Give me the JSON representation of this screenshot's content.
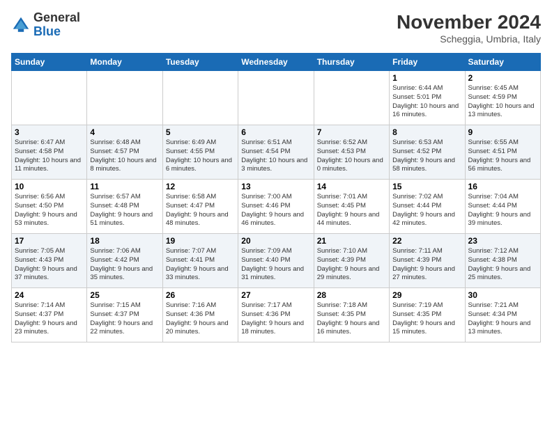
{
  "header": {
    "logo_general": "General",
    "logo_blue": "Blue",
    "month_title": "November 2024",
    "location": "Scheggia, Umbria, Italy"
  },
  "weekdays": [
    "Sunday",
    "Monday",
    "Tuesday",
    "Wednesday",
    "Thursday",
    "Friday",
    "Saturday"
  ],
  "weeks": [
    [
      {
        "day": "",
        "info": ""
      },
      {
        "day": "",
        "info": ""
      },
      {
        "day": "",
        "info": ""
      },
      {
        "day": "",
        "info": ""
      },
      {
        "day": "",
        "info": ""
      },
      {
        "day": "1",
        "info": "Sunrise: 6:44 AM\nSunset: 5:01 PM\nDaylight: 10 hours and 16 minutes."
      },
      {
        "day": "2",
        "info": "Sunrise: 6:45 AM\nSunset: 4:59 PM\nDaylight: 10 hours and 13 minutes."
      }
    ],
    [
      {
        "day": "3",
        "info": "Sunrise: 6:47 AM\nSunset: 4:58 PM\nDaylight: 10 hours and 11 minutes."
      },
      {
        "day": "4",
        "info": "Sunrise: 6:48 AM\nSunset: 4:57 PM\nDaylight: 10 hours and 8 minutes."
      },
      {
        "day": "5",
        "info": "Sunrise: 6:49 AM\nSunset: 4:55 PM\nDaylight: 10 hours and 6 minutes."
      },
      {
        "day": "6",
        "info": "Sunrise: 6:51 AM\nSunset: 4:54 PM\nDaylight: 10 hours and 3 minutes."
      },
      {
        "day": "7",
        "info": "Sunrise: 6:52 AM\nSunset: 4:53 PM\nDaylight: 10 hours and 0 minutes."
      },
      {
        "day": "8",
        "info": "Sunrise: 6:53 AM\nSunset: 4:52 PM\nDaylight: 9 hours and 58 minutes."
      },
      {
        "day": "9",
        "info": "Sunrise: 6:55 AM\nSunset: 4:51 PM\nDaylight: 9 hours and 56 minutes."
      }
    ],
    [
      {
        "day": "10",
        "info": "Sunrise: 6:56 AM\nSunset: 4:50 PM\nDaylight: 9 hours and 53 minutes."
      },
      {
        "day": "11",
        "info": "Sunrise: 6:57 AM\nSunset: 4:48 PM\nDaylight: 9 hours and 51 minutes."
      },
      {
        "day": "12",
        "info": "Sunrise: 6:58 AM\nSunset: 4:47 PM\nDaylight: 9 hours and 48 minutes."
      },
      {
        "day": "13",
        "info": "Sunrise: 7:00 AM\nSunset: 4:46 PM\nDaylight: 9 hours and 46 minutes."
      },
      {
        "day": "14",
        "info": "Sunrise: 7:01 AM\nSunset: 4:45 PM\nDaylight: 9 hours and 44 minutes."
      },
      {
        "day": "15",
        "info": "Sunrise: 7:02 AM\nSunset: 4:44 PM\nDaylight: 9 hours and 42 minutes."
      },
      {
        "day": "16",
        "info": "Sunrise: 7:04 AM\nSunset: 4:44 PM\nDaylight: 9 hours and 39 minutes."
      }
    ],
    [
      {
        "day": "17",
        "info": "Sunrise: 7:05 AM\nSunset: 4:43 PM\nDaylight: 9 hours and 37 minutes."
      },
      {
        "day": "18",
        "info": "Sunrise: 7:06 AM\nSunset: 4:42 PM\nDaylight: 9 hours and 35 minutes."
      },
      {
        "day": "19",
        "info": "Sunrise: 7:07 AM\nSunset: 4:41 PM\nDaylight: 9 hours and 33 minutes."
      },
      {
        "day": "20",
        "info": "Sunrise: 7:09 AM\nSunset: 4:40 PM\nDaylight: 9 hours and 31 minutes."
      },
      {
        "day": "21",
        "info": "Sunrise: 7:10 AM\nSunset: 4:39 PM\nDaylight: 9 hours and 29 minutes."
      },
      {
        "day": "22",
        "info": "Sunrise: 7:11 AM\nSunset: 4:39 PM\nDaylight: 9 hours and 27 minutes."
      },
      {
        "day": "23",
        "info": "Sunrise: 7:12 AM\nSunset: 4:38 PM\nDaylight: 9 hours and 25 minutes."
      }
    ],
    [
      {
        "day": "24",
        "info": "Sunrise: 7:14 AM\nSunset: 4:37 PM\nDaylight: 9 hours and 23 minutes."
      },
      {
        "day": "25",
        "info": "Sunrise: 7:15 AM\nSunset: 4:37 PM\nDaylight: 9 hours and 22 minutes."
      },
      {
        "day": "26",
        "info": "Sunrise: 7:16 AM\nSunset: 4:36 PM\nDaylight: 9 hours and 20 minutes."
      },
      {
        "day": "27",
        "info": "Sunrise: 7:17 AM\nSunset: 4:36 PM\nDaylight: 9 hours and 18 minutes."
      },
      {
        "day": "28",
        "info": "Sunrise: 7:18 AM\nSunset: 4:35 PM\nDaylight: 9 hours and 16 minutes."
      },
      {
        "day": "29",
        "info": "Sunrise: 7:19 AM\nSunset: 4:35 PM\nDaylight: 9 hours and 15 minutes."
      },
      {
        "day": "30",
        "info": "Sunrise: 7:21 AM\nSunset: 4:34 PM\nDaylight: 9 hours and 13 minutes."
      }
    ]
  ]
}
